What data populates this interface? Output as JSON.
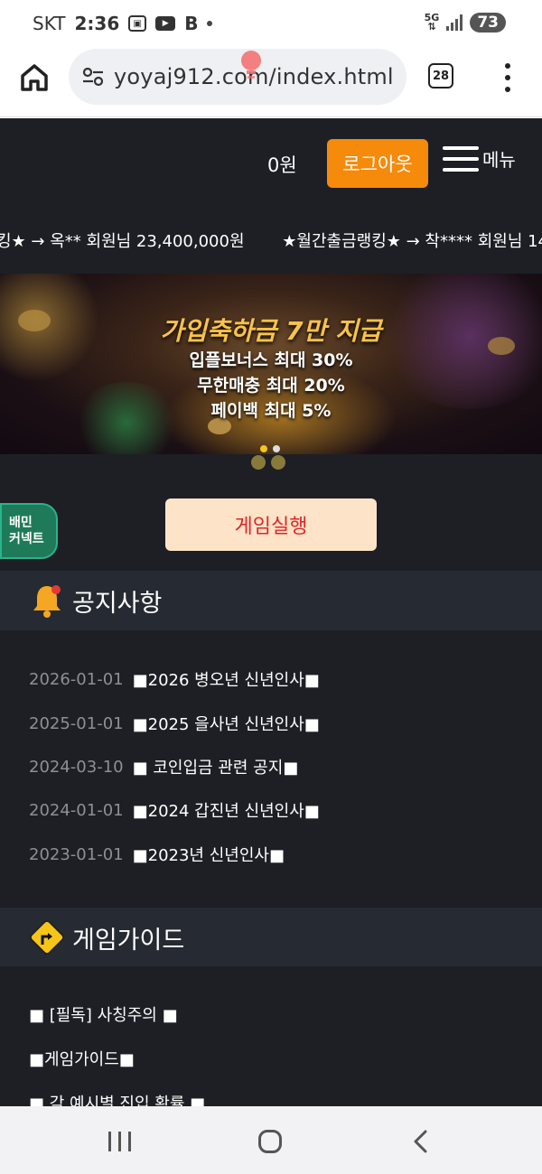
{
  "status_bar": {
    "carrier": "SKT",
    "time": "2:36",
    "network": "5G",
    "battery": "73"
  },
  "browser": {
    "url": "yoyaj912.com/index.html",
    "tab_count": "28"
  },
  "header": {
    "balance": "0원",
    "logout_label": "로그아웃",
    "menu_label": "메뉴"
  },
  "ticker": {
    "items": [
      "킹★ → 옥** 회원님 23,400,000원",
      "★월간출금랭킹★ → 착**** 회원님 14"
    ]
  },
  "banner": {
    "title": "가입축하금 7만 지급",
    "lines": [
      "입플보너스 최대 30%",
      "무한매충 최대 20%",
      "페이백 최대 5%"
    ]
  },
  "side_badge": {
    "line1": "배민",
    "line2": "커넥트"
  },
  "game_button_label": "게임실행",
  "notice": {
    "heading": "공지사항",
    "items": [
      {
        "date": "2026-01-01",
        "title": "■2026 병오년 신년인사■"
      },
      {
        "date": "2025-01-01",
        "title": "■2025 을사년 신년인사■"
      },
      {
        "date": "2024-03-10",
        "title": "■ 코인입금 관련 공지■"
      },
      {
        "date": "2024-01-01",
        "title": "■2024 갑진년 신년인사■"
      },
      {
        "date": "2023-01-01",
        "title": "■2023년 신년인사■"
      }
    ]
  },
  "guide": {
    "heading": "게임가이드",
    "items": [
      "■ [필독] 사칭주의 ■",
      "■게임가이드■",
      "■ 각 예시별 진입 확률 ■"
    ]
  },
  "colors": {
    "accent_orange": "#f58a0b",
    "game_button_bg": "#fde4c8",
    "game_button_text": "#e0242a",
    "page_bg": "#1d1f25"
  }
}
